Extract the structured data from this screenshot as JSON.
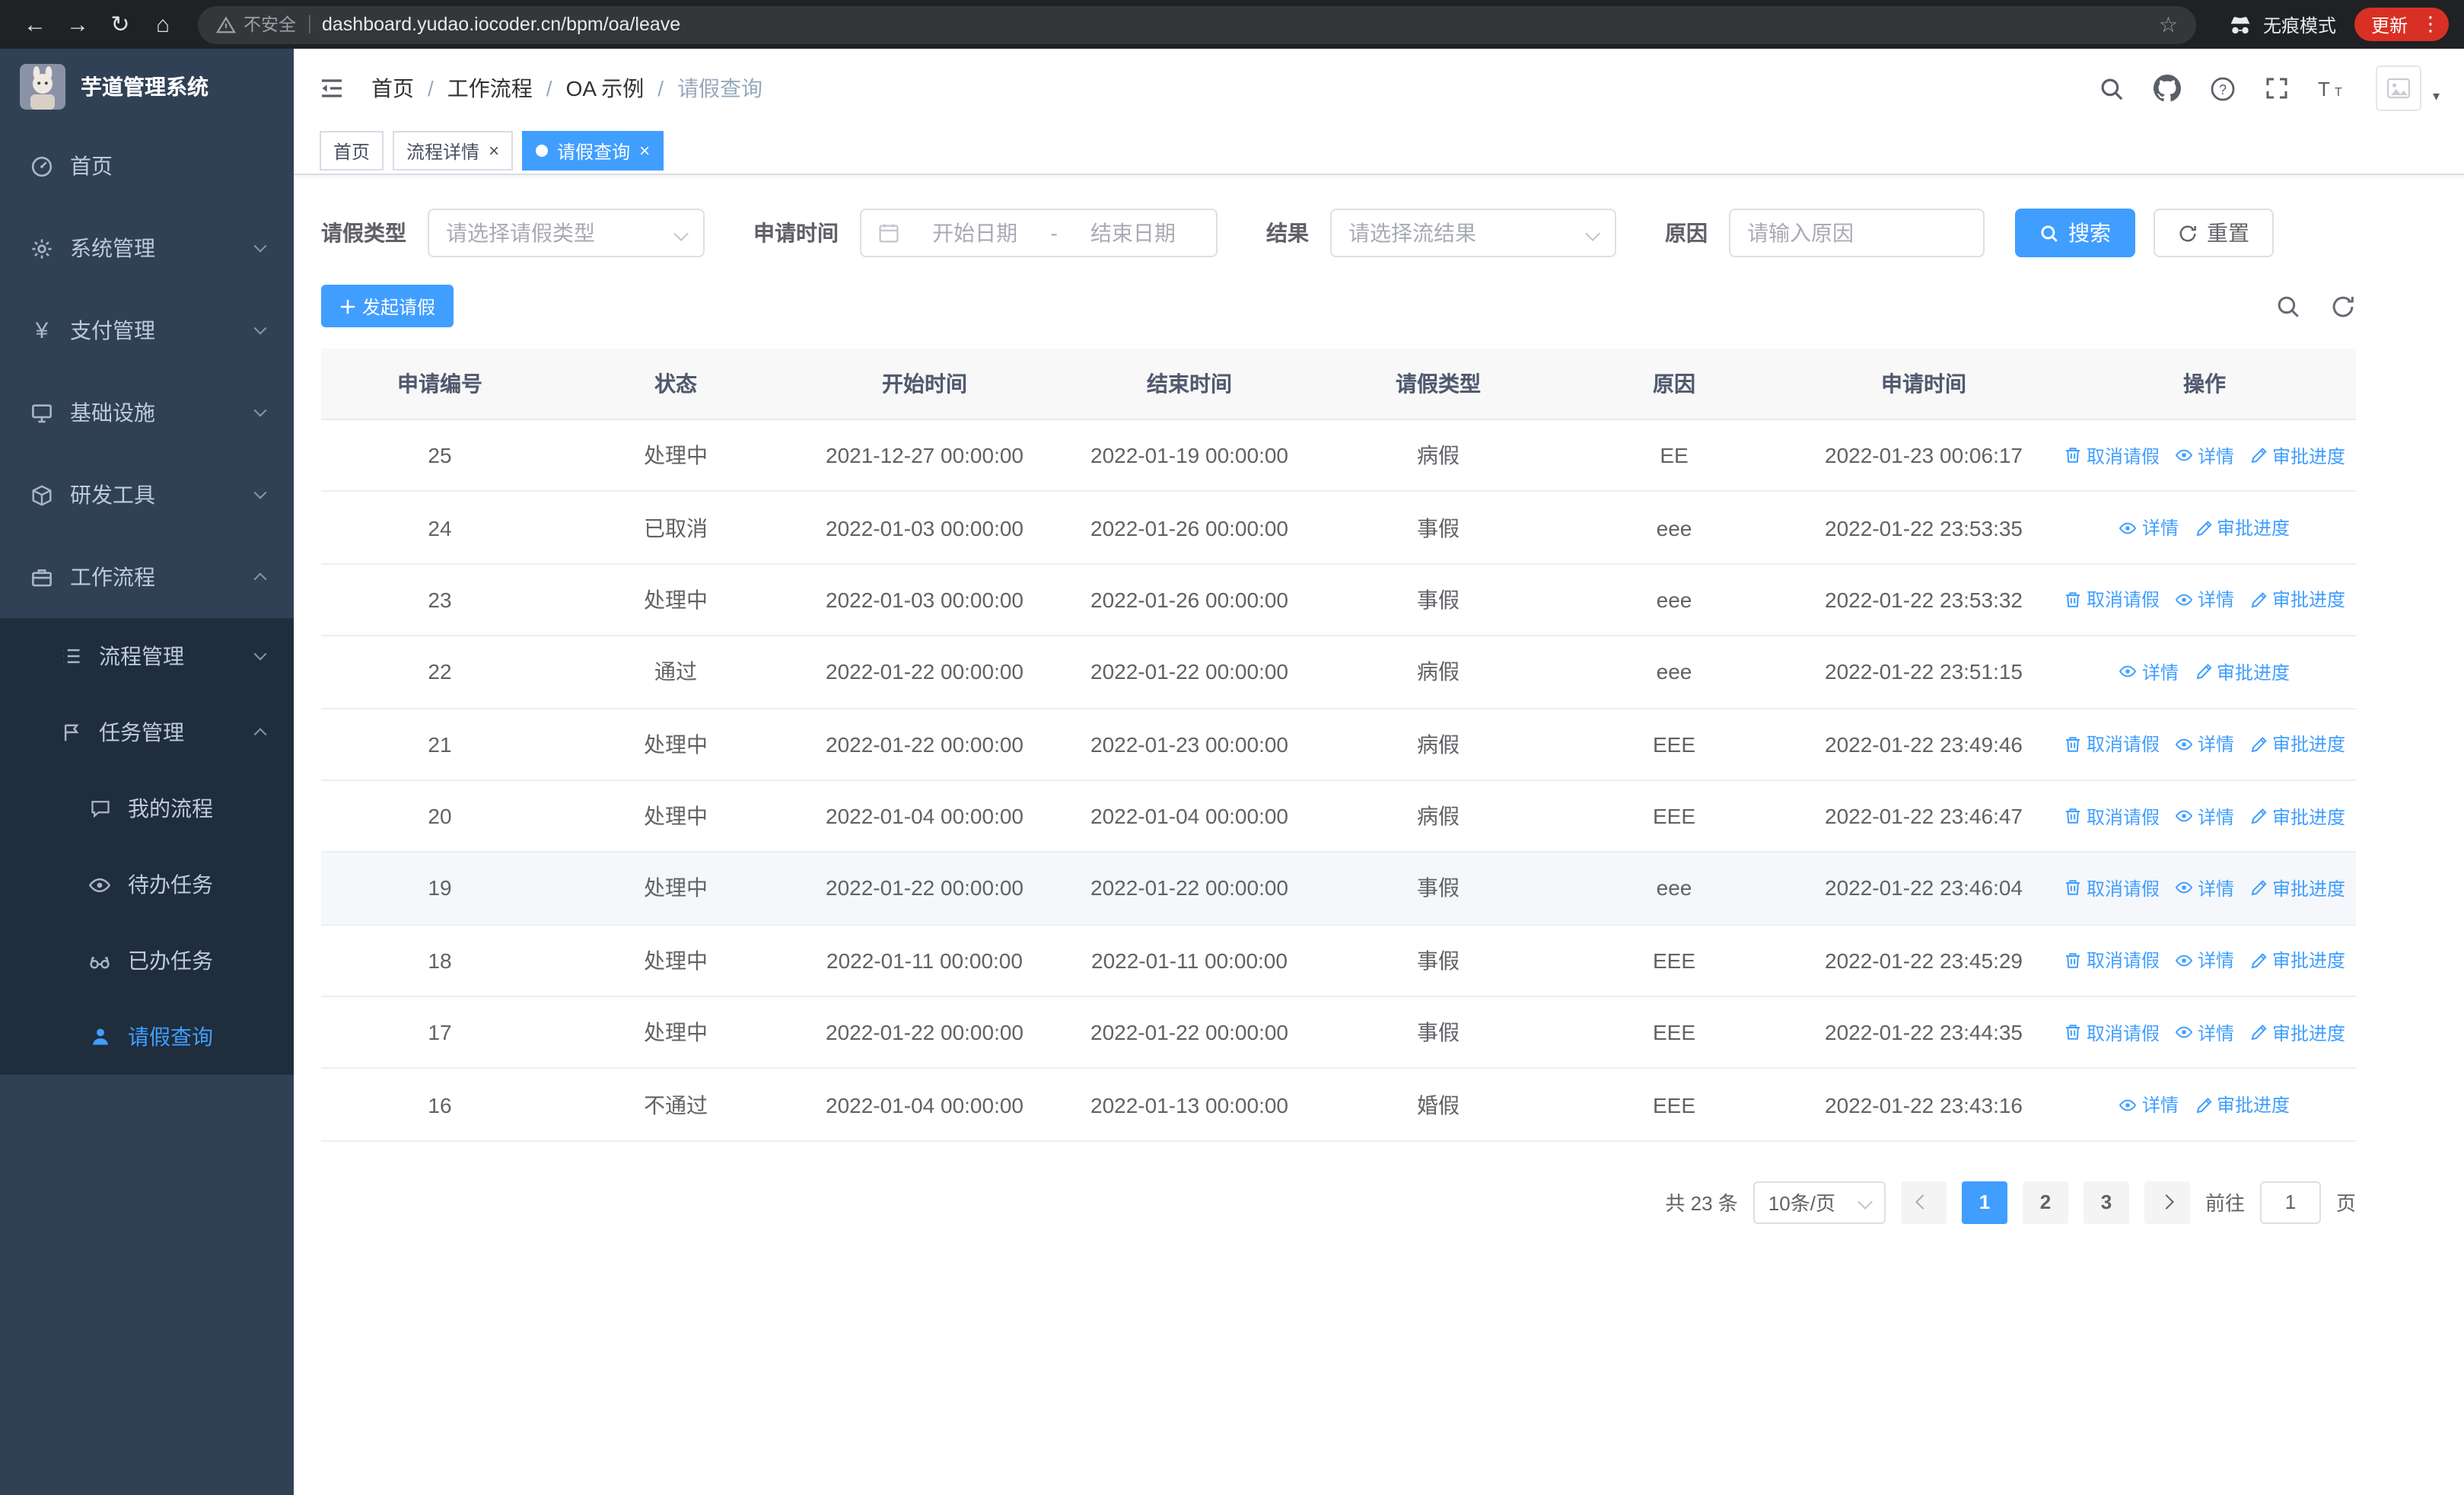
{
  "browser": {
    "security_label": "不安全",
    "url": "dashboard.yudao.iocoder.cn/bpm/oa/leave",
    "incognito_label": "无痕模式",
    "update_label": "更新"
  },
  "colors": {
    "accent": "#409eff",
    "sidebar_bg": "#304156",
    "submenu_bg": "#1f2d3d",
    "chrome_bg": "#202124",
    "update_pill": "#d93025",
    "row_highlight": "#f5f7fa"
  },
  "sidebar": {
    "app_title": "芋道管理系统",
    "items_top": [
      "首页",
      "系统管理",
      "支付管理",
      "基础设施",
      "研发工具",
      "工作流程"
    ],
    "items_process": [
      "流程管理",
      "任务管理"
    ],
    "items_task_children": [
      "我的流程",
      "待办任务",
      "已办任务",
      "请假查询"
    ],
    "active_item": "请假查询"
  },
  "navbar": {
    "breadcrumb": [
      "首页",
      "工作流程",
      "OA 示例",
      "请假查询"
    ]
  },
  "tabs": [
    "首页",
    "流程详情",
    "请假查询"
  ],
  "filters": {
    "leave_type_label": "请假类型",
    "leave_type_placeholder": "请选择请假类型",
    "apply_time_label": "申请时间",
    "start_date_placeholder": "开始日期",
    "date_separator": "-",
    "end_date_placeholder": "结束日期",
    "result_label": "结果",
    "result_placeholder": "请选择流结果",
    "reason_label": "原因",
    "reason_placeholder": "请输入原因",
    "search_button": "搜索",
    "reset_button": "重置"
  },
  "toolbar": {
    "create_label": "发起请假"
  },
  "table": {
    "columns": [
      "申请编号",
      "状态",
      "开始时间",
      "结束时间",
      "请假类型",
      "原因",
      "申请时间",
      "操作"
    ],
    "action_labels": {
      "cancel": "取消请假",
      "detail": "详情",
      "progress": "审批进度"
    },
    "rows": [
      {
        "id": "25",
        "status": "处理中",
        "start": "2021-12-27 00:00:00",
        "end": "2022-01-19 00:00:00",
        "type": "病假",
        "reason": "EE",
        "applied": "2022-01-23 00:06:17",
        "actions": [
          "cancel",
          "detail",
          "progress"
        ],
        "highlight": false
      },
      {
        "id": "24",
        "status": "已取消",
        "start": "2022-01-03 00:00:00",
        "end": "2022-01-26 00:00:00",
        "type": "事假",
        "reason": "eee",
        "applied": "2022-01-22 23:53:35",
        "actions": [
          "detail",
          "progress"
        ],
        "highlight": false
      },
      {
        "id": "23",
        "status": "处理中",
        "start": "2022-01-03 00:00:00",
        "end": "2022-01-26 00:00:00",
        "type": "事假",
        "reason": "eee",
        "applied": "2022-01-22 23:53:32",
        "actions": [
          "cancel",
          "detail",
          "progress"
        ],
        "highlight": false
      },
      {
        "id": "22",
        "status": "通过",
        "start": "2022-01-22 00:00:00",
        "end": "2022-01-22 00:00:00",
        "type": "病假",
        "reason": "eee",
        "applied": "2022-01-22 23:51:15",
        "actions": [
          "detail",
          "progress"
        ],
        "highlight": false
      },
      {
        "id": "21",
        "status": "处理中",
        "start": "2022-01-22 00:00:00",
        "end": "2022-01-23 00:00:00",
        "type": "病假",
        "reason": "EEE",
        "applied": "2022-01-22 23:49:46",
        "actions": [
          "cancel",
          "detail",
          "progress"
        ],
        "highlight": false
      },
      {
        "id": "20",
        "status": "处理中",
        "start": "2022-01-04 00:00:00",
        "end": "2022-01-04 00:00:00",
        "type": "病假",
        "reason": "EEE",
        "applied": "2022-01-22 23:46:47",
        "actions": [
          "cancel",
          "detail",
          "progress"
        ],
        "highlight": false
      },
      {
        "id": "19",
        "status": "处理中",
        "start": "2022-01-22 00:00:00",
        "end": "2022-01-22 00:00:00",
        "type": "事假",
        "reason": "eee",
        "applied": "2022-01-22 23:46:04",
        "actions": [
          "cancel",
          "detail",
          "progress"
        ],
        "highlight": true
      },
      {
        "id": "18",
        "status": "处理中",
        "start": "2022-01-11 00:00:00",
        "end": "2022-01-11 00:00:00",
        "type": "事假",
        "reason": "EEE",
        "applied": "2022-01-22 23:45:29",
        "actions": [
          "cancel",
          "detail",
          "progress"
        ],
        "highlight": false
      },
      {
        "id": "17",
        "status": "处理中",
        "start": "2022-01-22 00:00:00",
        "end": "2022-01-22 00:00:00",
        "type": "事假",
        "reason": "EEE",
        "applied": "2022-01-22 23:44:35",
        "actions": [
          "cancel",
          "detail",
          "progress"
        ],
        "highlight": false
      },
      {
        "id": "16",
        "status": "不通过",
        "start": "2022-01-04 00:00:00",
        "end": "2022-01-13 00:00:00",
        "type": "婚假",
        "reason": "EEE",
        "applied": "2022-01-22 23:43:16",
        "actions": [
          "detail",
          "progress"
        ],
        "highlight": false
      }
    ]
  },
  "pagination": {
    "total_text": "共 23 条",
    "page_size_text": "10条/页",
    "pages": [
      "1",
      "2",
      "3"
    ],
    "active_page": "1",
    "goto_label": "前往",
    "goto_value": "1",
    "page_suffix": "页"
  }
}
